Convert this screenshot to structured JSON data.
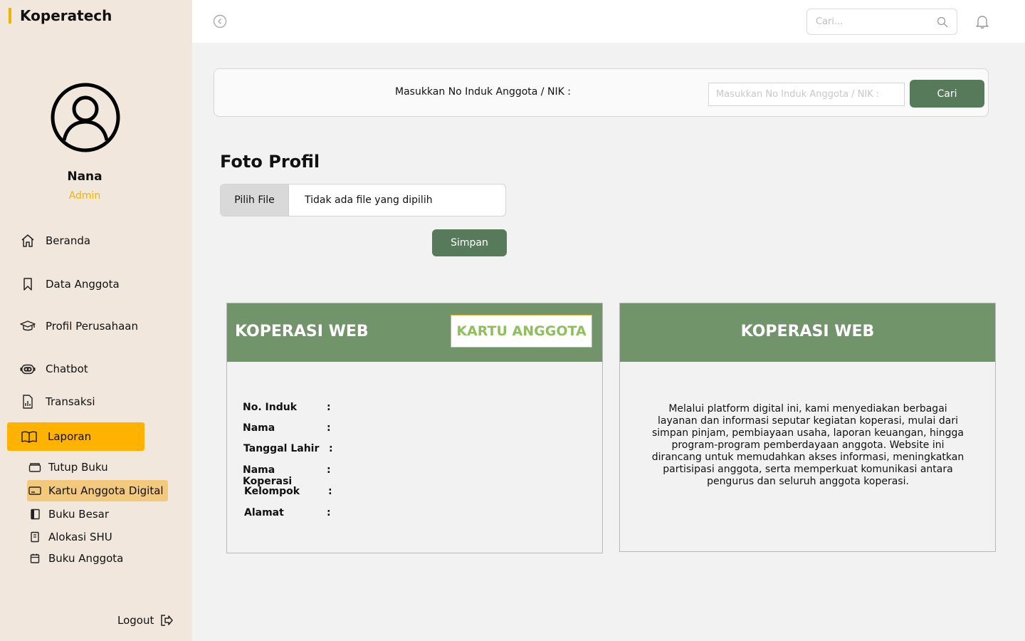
{
  "brand": {
    "name": "Koperatech"
  },
  "user": {
    "name": "Nana",
    "role": "Admin"
  },
  "nav": {
    "items": [
      {
        "label": "Beranda"
      },
      {
        "label": "Data Anggota"
      },
      {
        "label": "Profil Perusahaan"
      },
      {
        "label": "Chatbot"
      },
      {
        "label": "Transaksi"
      },
      {
        "label": "Laporan",
        "active": true
      }
    ],
    "sub_items": [
      {
        "label": "Tutup Buku"
      },
      {
        "label": "Kartu Anggota Digital",
        "active": true
      },
      {
        "label": "Buku Besar"
      },
      {
        "label": "Alokasi SHU"
      },
      {
        "label": "Buku Anggota"
      }
    ],
    "logout": "Logout"
  },
  "topbar": {
    "search_placeholder": "Cari..."
  },
  "lookup": {
    "label": "Masukkan No Induk Anggota / NIK :",
    "placeholder": "Masukkan No Induk Anggota / NIK :",
    "button": "Cari"
  },
  "photo": {
    "title": "Foto Profil",
    "choose_file": "Pilih File",
    "no_file": "Tidak ada file yang dipilih",
    "save": "Simpan"
  },
  "card_front": {
    "title": "KOPERASI WEB",
    "tag": "KARTU ANGGOTA",
    "fields": [
      {
        "label": "No. Induk",
        "sep": ":"
      },
      {
        "label": "Nama",
        "sep": ":"
      },
      {
        "label": "Tanggal Lahir",
        "sep": ":"
      },
      {
        "label": "Nama Koperasi",
        "sep": ":"
      },
      {
        "label": "Kelompok",
        "sep": ":"
      },
      {
        "label": "Alamat",
        "sep": ":"
      }
    ]
  },
  "card_back": {
    "title": "KOPERASI WEB",
    "description": "Melalui platform digital ini, kami menyediakan berbagai layanan dan informasi seputar kegiatan koperasi, mulai dari simpan pinjam, pembiayaan usaha, laporan keuangan, hingga program-program pemberdayaan anggota. Website ini dirancang untuk memudahkan akses informasi, meningkatkan partisipasi anggota, serta memperkuat komunikasi antara pengurus dan seluruh anggota koperasi."
  },
  "colors": {
    "sidebar_bg": "#f1e7dd",
    "accent": "#ffb300",
    "submenu_active": "#f3c97d",
    "button_green": "#577b5a",
    "card_header_green": "#71946a",
    "tag_text": "#8fbf5c"
  }
}
